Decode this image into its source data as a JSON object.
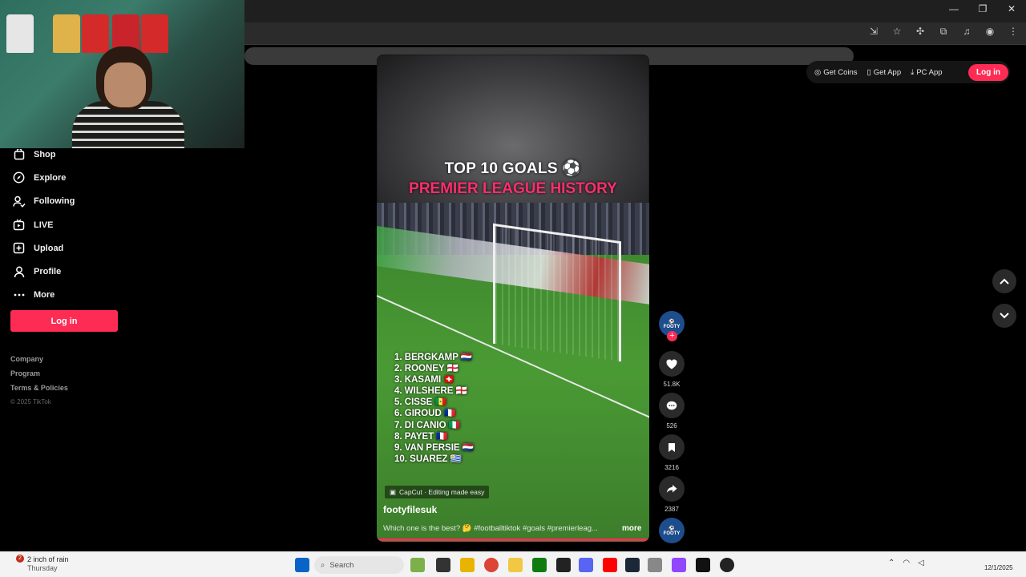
{
  "window": {
    "minimize": "—",
    "restore": "❐",
    "close": "✕"
  },
  "sidebar": {
    "items": [
      {
        "label": "Shop",
        "icon": "shop-icon"
      },
      {
        "label": "Explore",
        "icon": "compass-icon"
      },
      {
        "label": "Following",
        "icon": "following-icon"
      },
      {
        "label": "LIVE",
        "icon": "live-icon"
      },
      {
        "label": "Upload",
        "icon": "upload-icon"
      },
      {
        "label": "Profile",
        "icon": "profile-icon"
      },
      {
        "label": "More",
        "icon": "more-icon"
      }
    ],
    "login": "Log in",
    "footer": {
      "company": "Company",
      "program": "Program",
      "terms": "Terms & Policies",
      "copyright": "© 2025 TikTok"
    }
  },
  "header": {
    "get_coins": "Get Coins",
    "get_app": "Get App",
    "pc_app": "PC App",
    "login": "Log in"
  },
  "video": {
    "title_line1": "TOP 10 GOALS ⚽",
    "title_line2": "PREMIER LEAGUE HISTORY",
    "ranking": [
      "1. BERGKAMP 🇳🇱",
      "2. ROONEY 🏴󠁧󠁢󠁥󠁮󠁧󠁿",
      "3. KASAMI 🇨🇭",
      "4. WILSHERE 🏴󠁧󠁢󠁥󠁮󠁧󠁿",
      "5. CISSE 🇸🇳",
      "6. GIROUD 🇫🇷",
      "7. DI CANIO 🇮🇹",
      "8. PAYET 🇫🇷",
      "9. VAN PERSIE 🇳🇱",
      "10. SUAREZ 🇺🇾"
    ],
    "capcut": "CapCut · Editing made easy",
    "username": "footyfilesuk",
    "caption": "Which one is the best? 🤔 #footballtiktok #goals #premierleag...",
    "more": "more",
    "progress": 1.0
  },
  "rail": {
    "avatar_text": "FOOTY",
    "likes": "51.8K",
    "comments": "526",
    "saves": "3216",
    "shares": "2387"
  },
  "taskbar": {
    "weather_badge": "2",
    "weather": "2 inch of rain",
    "weather_day": "Thursday",
    "search_placeholder": "Search",
    "date": "12/1/2025"
  }
}
